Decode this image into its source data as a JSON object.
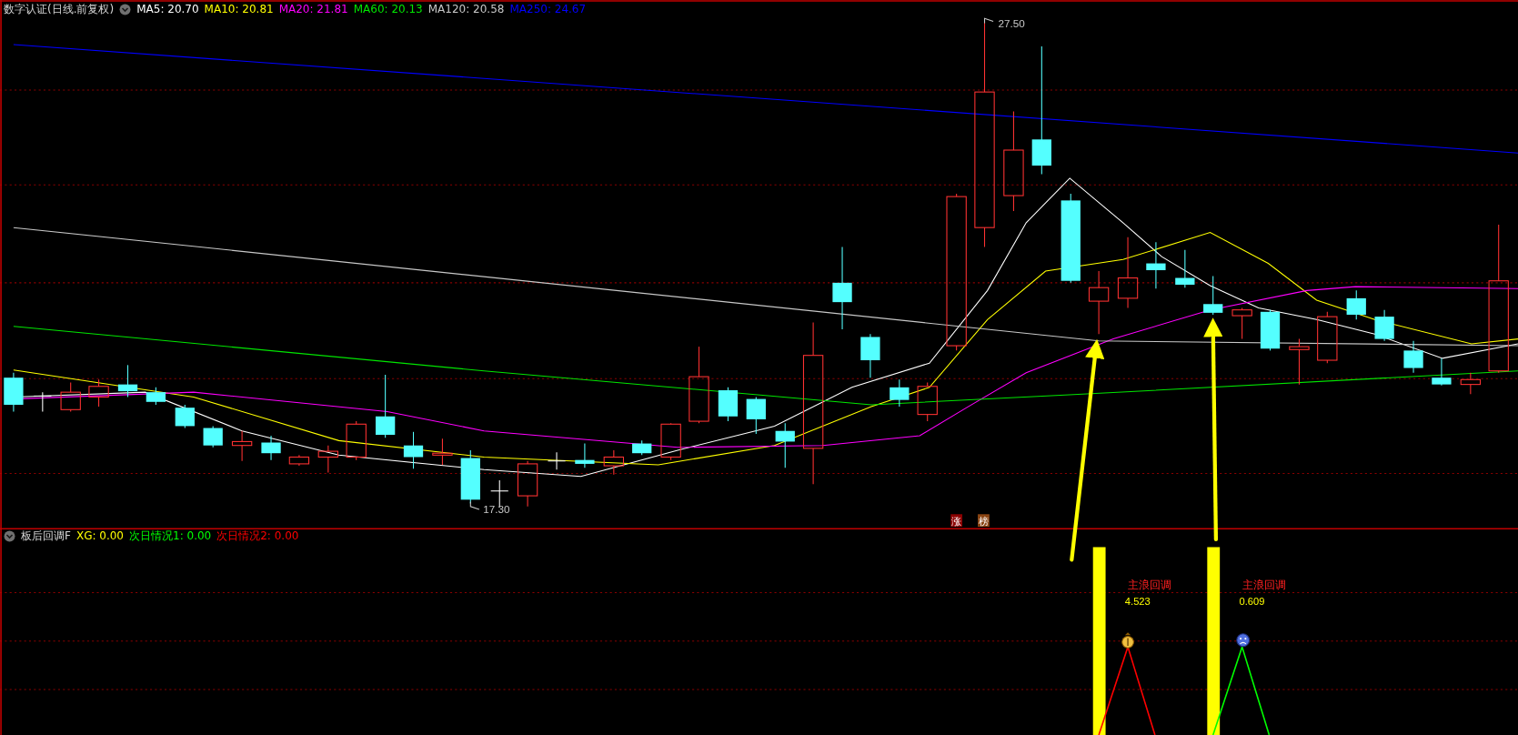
{
  "main_chart": {
    "title": "数字认证(日线.前复权)",
    "indicators": [
      {
        "label": "MA5: 20.70",
        "color": "#ffffff"
      },
      {
        "label": "MA10: 20.81",
        "color": "#ffff00"
      },
      {
        "label": "MA20: 21.81",
        "color": "#ff00ff"
      },
      {
        "label": "MA60: 20.13",
        "color": "#00e600"
      },
      {
        "label": "MA120: 20.58",
        "color": "#c8c8c8"
      },
      {
        "label": "MA250: 24.67",
        "color": "#0000ff"
      }
    ],
    "price_labels": [
      {
        "text": "27.50"
      },
      {
        "text": "17.30"
      }
    ],
    "badges": [
      {
        "text": "涨",
        "color": "#8b0000"
      },
      {
        "text": "榜",
        "color": "#8b4513"
      }
    ]
  },
  "sub_chart": {
    "title": "板后回调F",
    "indicators": [
      {
        "label": "XG: 0.00",
        "color": "#ffff00"
      },
      {
        "label": "次日情况1: 0.00",
        "color": "#00ff00"
      },
      {
        "label": "次日情况2: 0.00",
        "color": "#ff0000"
      }
    ],
    "signals": [
      {
        "label": "主浪回调",
        "value": "4.523",
        "kind": "money"
      },
      {
        "label": "主浪回调",
        "value": "0.609",
        "kind": "sad"
      }
    ]
  }
}
